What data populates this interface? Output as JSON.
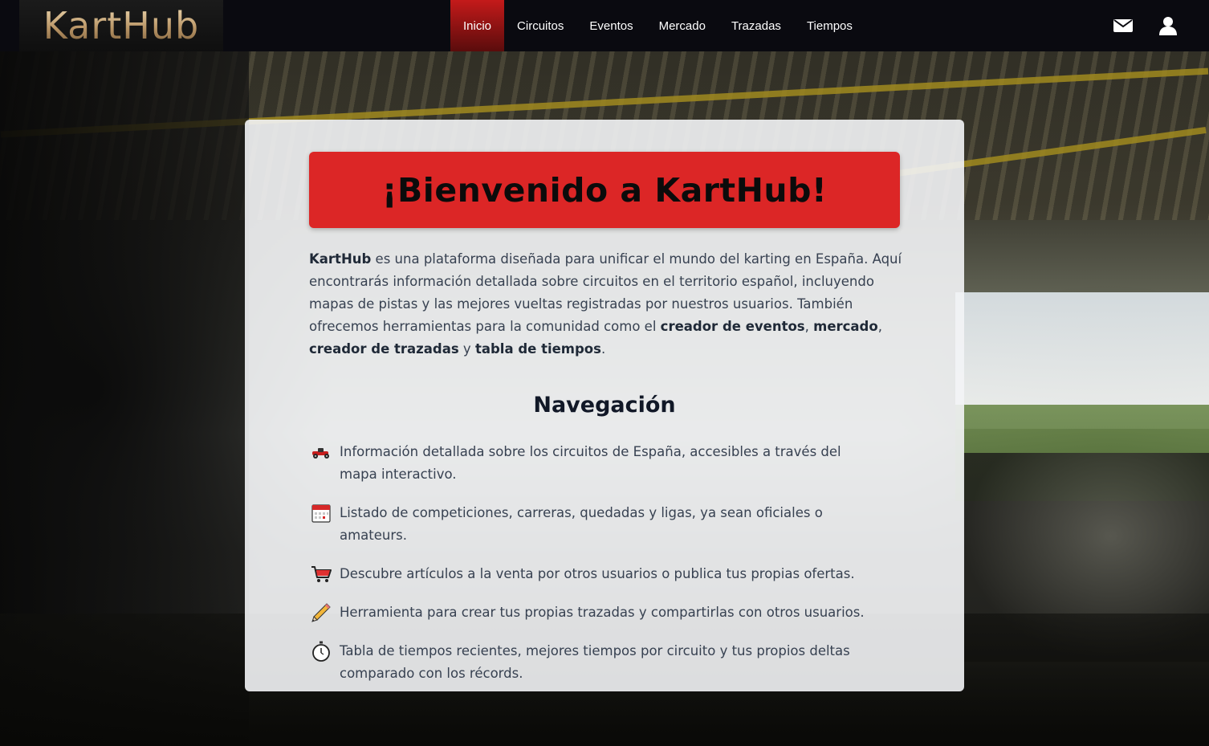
{
  "app": {
    "logo_text": "KartHub"
  },
  "nav": {
    "items": [
      {
        "label": "Inicio",
        "active": true
      },
      {
        "label": "Circuitos",
        "active": false
      },
      {
        "label": "Eventos",
        "active": false
      },
      {
        "label": "Mercado",
        "active": false
      },
      {
        "label": "Trazadas",
        "active": false
      },
      {
        "label": "Tiempos",
        "active": false
      }
    ],
    "icons": [
      "envelope-icon",
      "user-icon"
    ]
  },
  "hero": {
    "title": "¡Bienvenido a KartHub!",
    "intro": {
      "p1": "KartHub",
      "p2": " es una plataforma diseñada para unificar el mundo del karting en España. Aquí encontrarás información detallada sobre circuitos en el territorio español, incluyendo mapas de pistas y las mejores vueltas registradas por nuestros usuarios. También ofrecemos herramientas para la comunidad como el ",
      "p3": "creador de eventos",
      "p4": ", ",
      "p5": "mercado",
      "p6": ", ",
      "p7": "creador de trazadas",
      "p8": " y ",
      "p9": "tabla de tiempos",
      "p10": "."
    }
  },
  "navigation_section": {
    "title": "Navegación",
    "features": [
      {
        "icon": "kart-icon",
        "text": "Información detallada sobre los circuitos de España, accesibles a través del mapa interactivo."
      },
      {
        "icon": "calendar-icon",
        "text": "Listado de competiciones, carreras, quedadas y ligas, ya sean oficiales o amateurs."
      },
      {
        "icon": "cart-icon",
        "text": "Descubre artículos a la venta por otros usuarios o publica tus propias ofertas."
      },
      {
        "icon": "pencil-icon",
        "text": "Herramienta para crear tus propias trazadas y compartirlas con otros usuarios."
      },
      {
        "icon": "stopwatch-icon",
        "text": "Tabla de tiempos recientes, mejores tiempos por circuito y tus propios deltas comparado con los récords."
      }
    ]
  },
  "colors": {
    "accent": "#dc2626",
    "nav_bg": "#0a0a10",
    "nav_active": "#c41a1a"
  }
}
